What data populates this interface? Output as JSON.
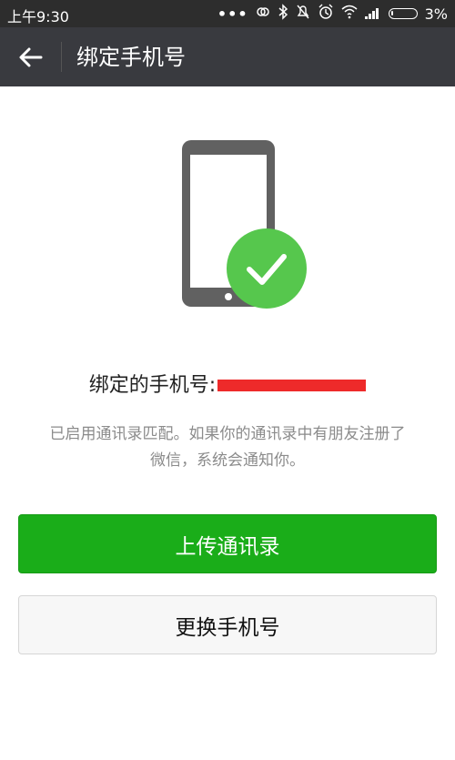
{
  "status_bar": {
    "time": "上午9:30",
    "battery": "3%",
    "icons": [
      "more-dots-icon",
      "nfc-icon",
      "bluetooth-icon",
      "mute-icon",
      "alarm-icon",
      "wifi-icon",
      "signal-icon",
      "battery-icon"
    ]
  },
  "action_bar": {
    "title": "绑定手机号",
    "back_icon": "back-arrow-icon"
  },
  "illustration": {
    "icon": "phone-check-icon",
    "check_color": "#56c74d"
  },
  "bound_info": {
    "label": "绑定的手机号:",
    "number_redacted": true
  },
  "description": {
    "line1": "已启用通讯录匹配。如果你的通讯录中有朋友注册了",
    "line2": "微信，系统会通知你。"
  },
  "buttons": {
    "upload_contacts": "上传通讯录",
    "change_phone": "更换手机号"
  },
  "colors": {
    "primary": "#1aad19",
    "actionbar": "#393a3f",
    "statusbar": "#2d2d2d"
  }
}
